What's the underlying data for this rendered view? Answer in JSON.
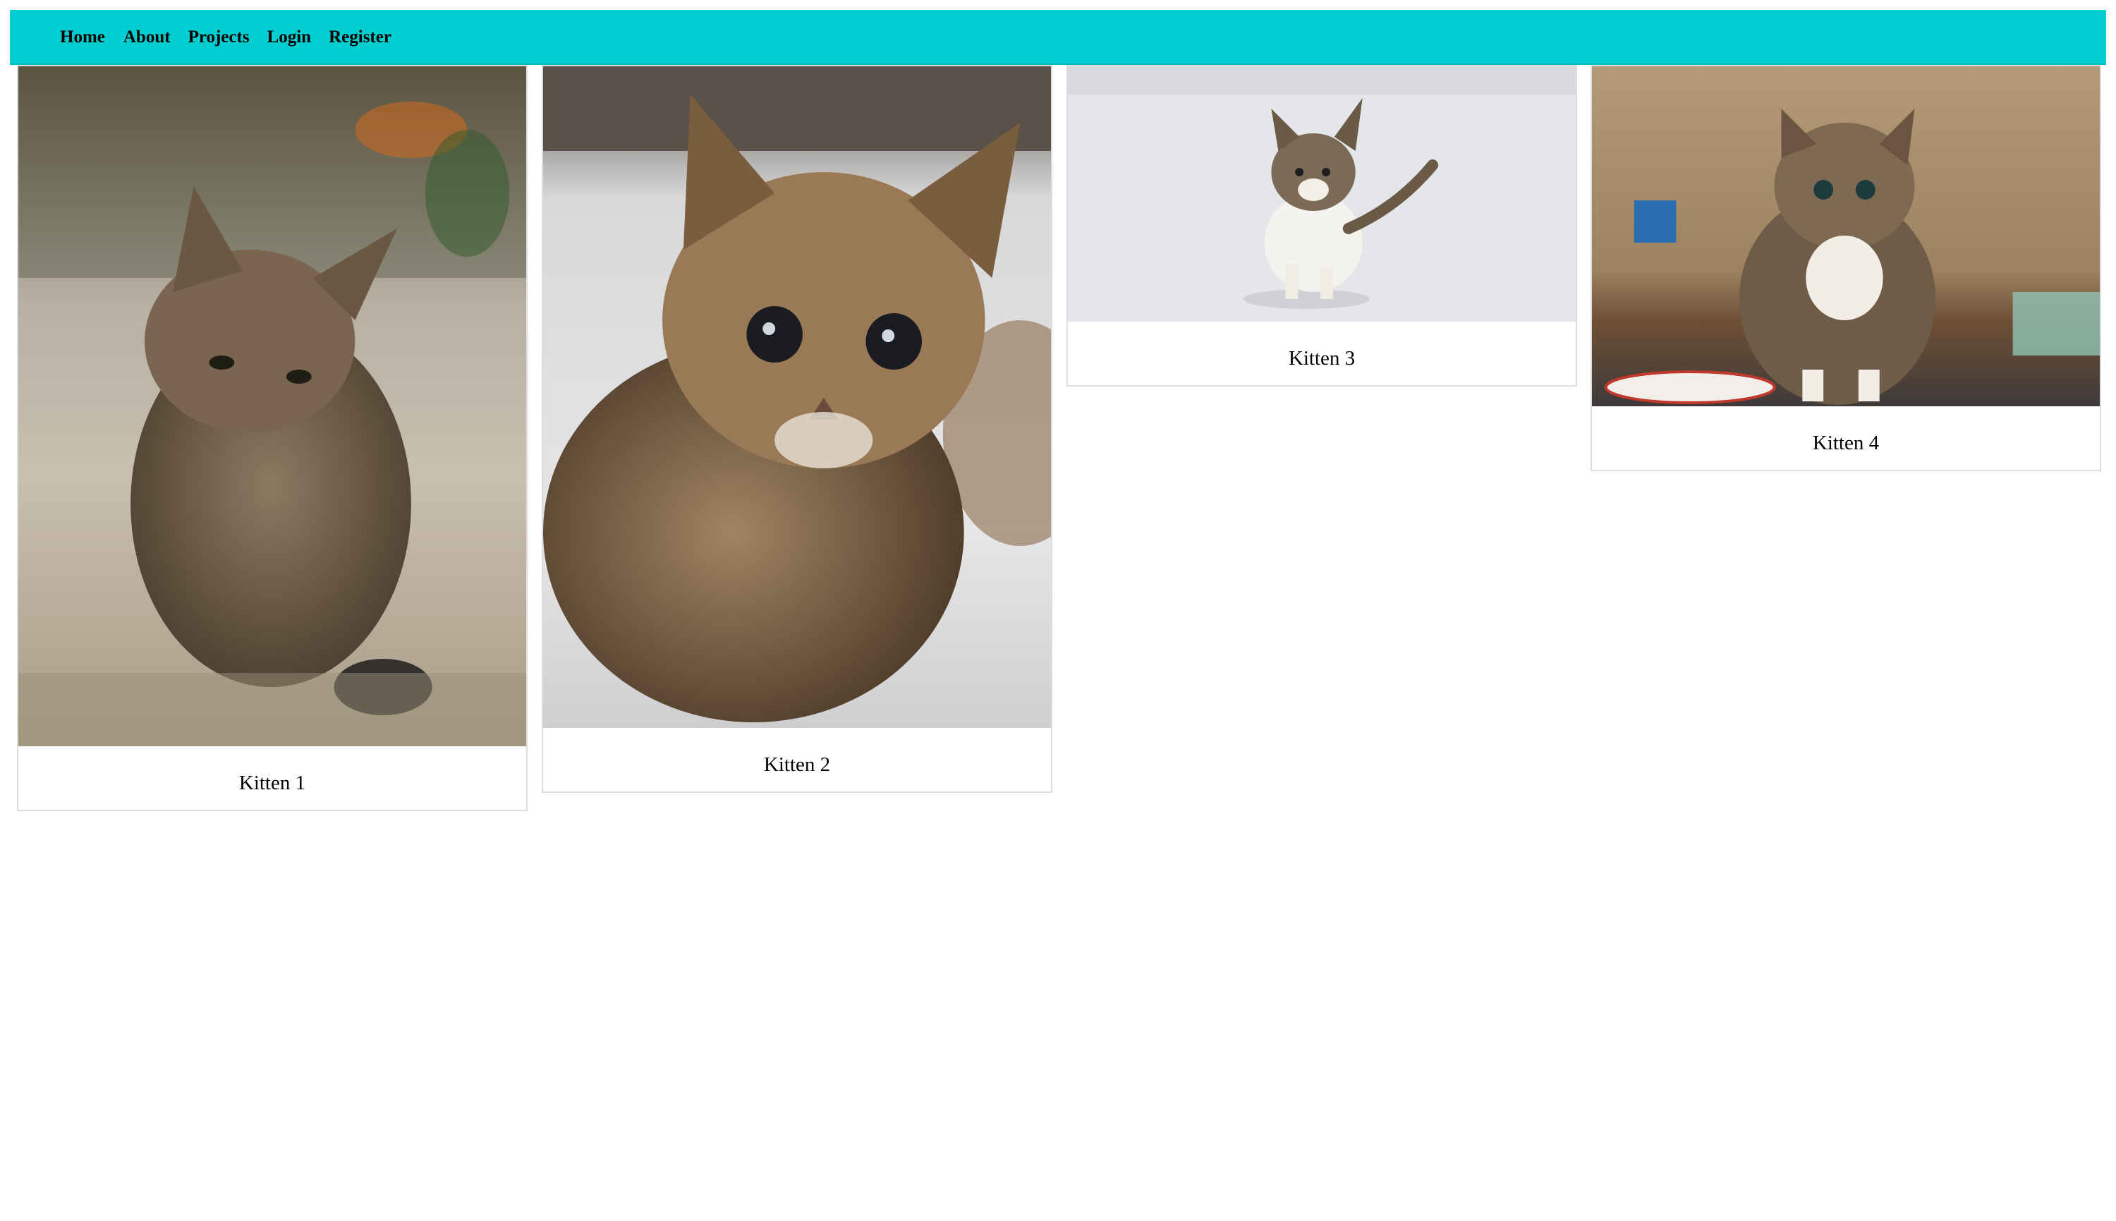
{
  "nav": {
    "home": "Home",
    "about": "About",
    "projects": "Projects",
    "login": "Login",
    "register": "Register"
  },
  "colors": {
    "navbar_background": "#00ced1",
    "card_border": "#dcdcdc",
    "page_background": "#ffffff"
  },
  "gallery": {
    "items": [
      {
        "caption": "Kitten 1"
      },
      {
        "caption": "Kitten 2"
      },
      {
        "caption": "Kitten 3"
      },
      {
        "caption": "Kitten 4"
      }
    ]
  }
}
